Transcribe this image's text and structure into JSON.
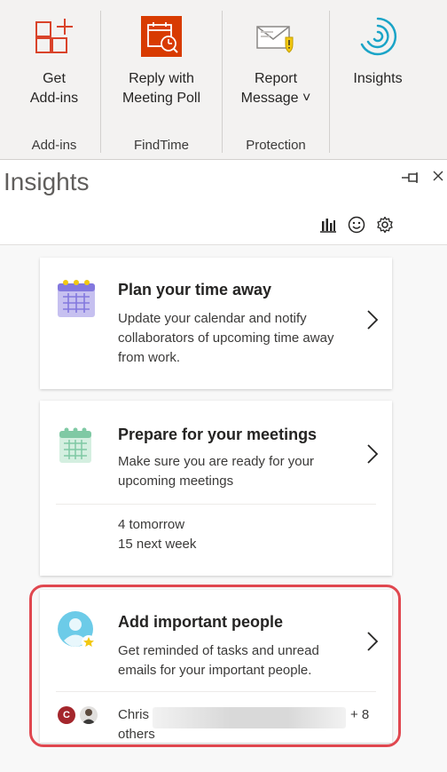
{
  "ribbon": {
    "groups": [
      {
        "label": "Add-ins",
        "buttons": [
          {
            "label_line1": "Get",
            "label_line2": "Add-ins",
            "icon": "get-add-ins-icon"
          }
        ]
      },
      {
        "label": "FindTime",
        "buttons": [
          {
            "label_line1": "Reply with",
            "label_line2": "Meeting Poll",
            "icon": "meeting-poll-icon"
          }
        ]
      },
      {
        "label": "Protection",
        "buttons": [
          {
            "label_line1": "Report",
            "label_line2": "Message ˅",
            "icon": "report-message-icon"
          }
        ]
      },
      {
        "label": "",
        "buttons": [
          {
            "label_line1": "Insights",
            "label_line2": "",
            "icon": "insights-icon"
          }
        ]
      }
    ]
  },
  "pane": {
    "title": "Insights",
    "header_icons": [
      "chart-icon",
      "smiley-icon",
      "gear-icon"
    ]
  },
  "cards": [
    {
      "title": "Plan your time away",
      "description": "Update your calendar and notify collaborators of upcoming time away from work.",
      "icon": "calendar-plan-icon"
    },
    {
      "title": "Prepare for your meetings",
      "description": "Make sure you are ready for your upcoming meetings",
      "icon": "calendar-meetings-icon",
      "footer_line1": "4 tomorrow",
      "footer_line2": "15 next week"
    },
    {
      "title": "Add important people",
      "description": "Get reminded of tasks and unread emails for your important people.",
      "icon": "person-star-icon",
      "footer_name": "Chris",
      "footer_more": "+ 8",
      "footer_others": "others",
      "avatar_initial": "C"
    }
  ],
  "colors": {
    "findtime_orange": "#d83b01",
    "addins_red": "#d9432a",
    "insights_teal": "#1aa4c7",
    "highlight_red": "#e0474f",
    "calendar_purple": "#8378de",
    "calendar_green": "#7fc9a4"
  }
}
